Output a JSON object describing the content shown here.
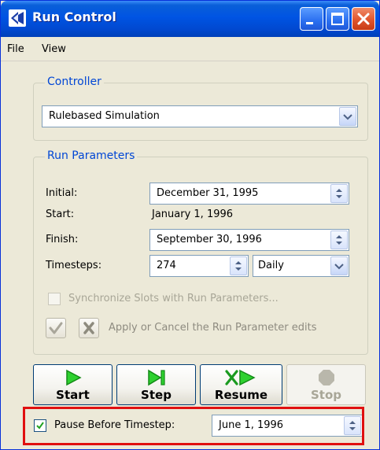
{
  "window": {
    "title": "Run Control"
  },
  "menu": {
    "file": "File",
    "view": "View"
  },
  "controller": {
    "group_title": "Controller",
    "selected": "Rulebased Simulation"
  },
  "run_parameters": {
    "group_title": "Run Parameters",
    "initial_label": "Initial:",
    "initial_value": "December 31, 1995",
    "start_label": "Start:",
    "start_value": "January 1, 1996",
    "finish_label": "Finish:",
    "finish_value": "September 30, 1996",
    "timesteps_label": "Timesteps:",
    "timesteps_value": "274",
    "timestep_unit": "Daily",
    "sync_label": "Synchronize Slots with Run Parameters...",
    "sync_checked": false,
    "apply_label": "Apply or Cancel the Run Parameter edits"
  },
  "controls": {
    "start": "Start",
    "step": "Step",
    "resume": "Resume",
    "stop": "Stop"
  },
  "pause": {
    "label": "Pause Before Timestep:",
    "checked": true,
    "value": "June 1, 1996"
  },
  "colors": {
    "title_blue": "#0054e3",
    "group_title": "#0046d5",
    "play_green": "#22c02a",
    "highlight_red": "#e01010"
  },
  "icons": {
    "app": "run-control-icon",
    "minimize": "minimize-icon",
    "maximize": "maximize-icon",
    "close": "close-icon",
    "apply": "checkmark-icon",
    "cancel": "cancel-x-icon",
    "start": "play-icon",
    "step": "step-icon",
    "resume": "resume-icon",
    "stop": "stop-icon"
  }
}
